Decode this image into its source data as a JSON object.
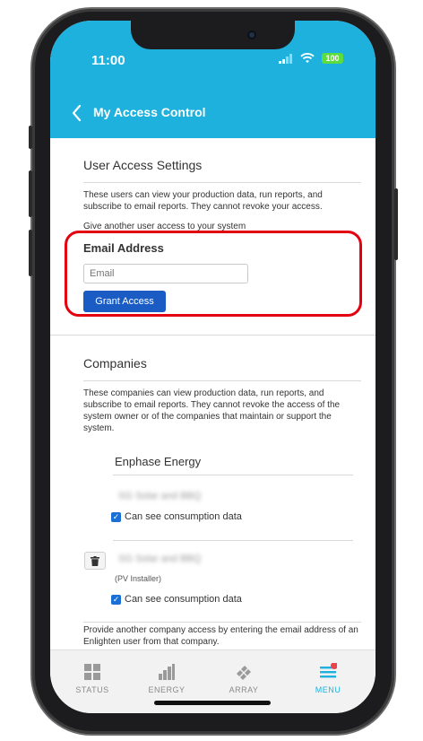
{
  "status_bar": {
    "time": "11:00",
    "battery": "100"
  },
  "nav": {
    "title": "My Access Control"
  },
  "user_access": {
    "title": "User Access Settings",
    "description": "These users can view your production data, run reports, and subscribe to email reports. They cannot revoke your access.",
    "give_access_text": "Give another user access to your system",
    "email_label": "Email Address",
    "email_placeholder": "Email",
    "grant_button": "Grant Access"
  },
  "companies": {
    "title": "Companies",
    "description": "These companies can view production data, run reports, and subscribe to email reports. They cannot revoke the access of the system owner or of the companies that maintain or support the system.",
    "company_name": "Enphase Energy",
    "entries": [
      {
        "name": "SG Solar and BBQ",
        "checkbox_label": "Can see consumption data"
      },
      {
        "name": "SG Solar and BBQ",
        "role": "(PV Installer)",
        "checkbox_label": "Can see consumption data"
      }
    ],
    "footer_text": "Provide another company access by entering the email address of an Enlighten user from that company."
  },
  "tabbar": {
    "tabs": [
      {
        "label": "STATUS",
        "icon": "grid-icon"
      },
      {
        "label": "ENERGY",
        "icon": "bar-chart-icon"
      },
      {
        "label": "ARRAY",
        "icon": "solar-array-icon"
      },
      {
        "label": "MENU",
        "icon": "menu-icon"
      }
    ],
    "active_color": "#1eb1de",
    "notification_color": "#e8444d"
  },
  "colors": {
    "header": "#1eb1de",
    "button": "#1a5bc4",
    "highlight": "#e3000f"
  }
}
